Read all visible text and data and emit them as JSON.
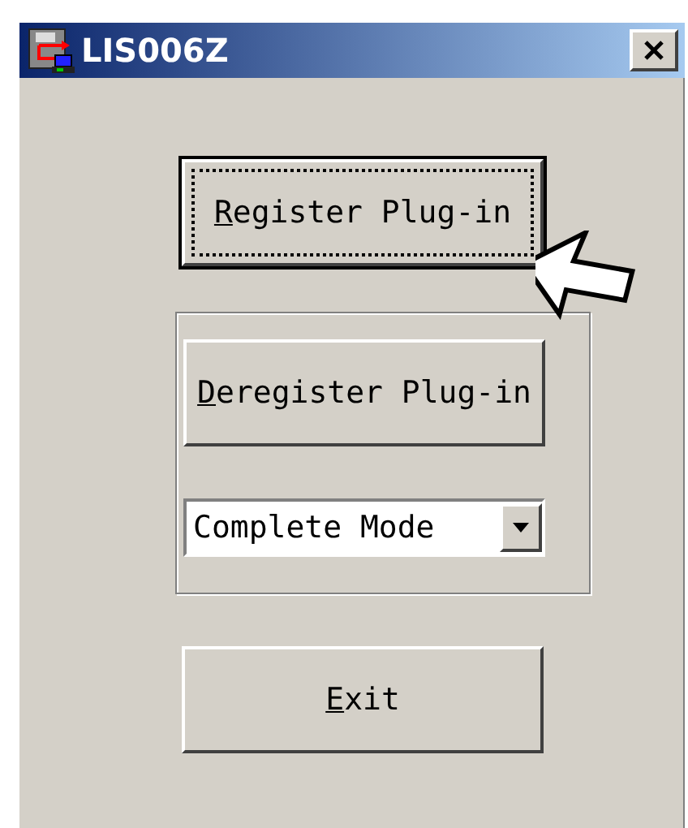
{
  "window": {
    "title": "LIS006Z"
  },
  "register_button": {
    "label": "Register Plug-in",
    "focused": true
  },
  "group": {
    "deregister_button": {
      "label": "Deregister Plug-in",
      "focused": false
    },
    "mode_dropdown": {
      "value": "Complete Mode"
    }
  },
  "exit_button": {
    "label": "Exit",
    "focused": false
  }
}
